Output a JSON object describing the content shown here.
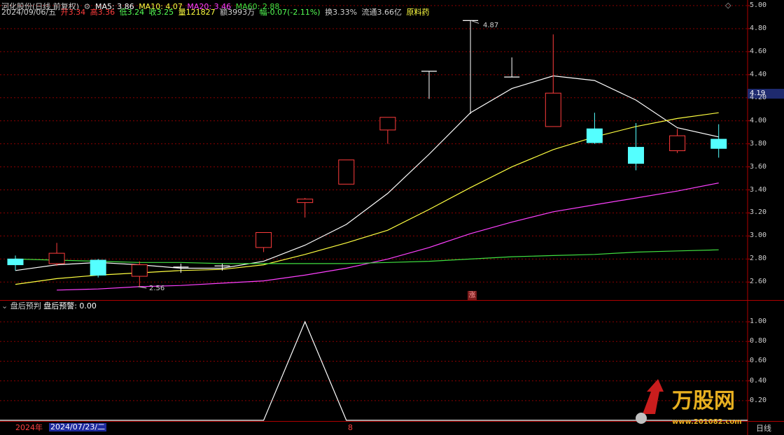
{
  "header": {
    "stock_name": "河化股份(日线 前复权)",
    "ma5_label": "MA5: 3.86",
    "ma10_label": "MA10: 4.07",
    "ma20_label": "MA20: 3.46",
    "ma60_label": "MA60: 2.88",
    "date": "2024/09/06/五",
    "open_label": "开3.34",
    "high_label": "高3.36",
    "low_label": "低3.24",
    "close_label": "收3.25",
    "volume_label": "量121827",
    "amount_label": "额3993万",
    "change_label": "幅-0.07(-2.11%)",
    "turnover_label": "换3.33%",
    "float_label": "流通3.66亿",
    "sector_label": "原料药",
    "corner_icon_text": "◇"
  },
  "indicator": {
    "title": "盘后预判",
    "value_label": "盘后预警: 0.00"
  },
  "footer": {
    "year_label": "2024年",
    "date_label": "2024/07/23/二",
    "marker_label": "8",
    "period_label": "日线"
  },
  "annotations": {
    "high_price": "4.87",
    "low_price": "2.56",
    "limit_up_badge": "涨",
    "current_price_tag": "4.19"
  },
  "watermark": {
    "brand": "万股网",
    "url": "www.201082.com"
  },
  "colors": {
    "up": "#ff3c3c",
    "down": "#54ffff",
    "ma5": "#ffffff",
    "ma10": "#ffff40",
    "ma20": "#ff40ff",
    "ma60": "#40e040",
    "grid": "#8b0000",
    "axis_text": "#d0d0d0"
  },
  "chart_data": [
    {
      "type": "candlestick",
      "title": "河化股份(日线 前复权)",
      "ylim": [
        2.45,
        5.0
      ],
      "y_ticks": [
        2.6,
        2.8,
        3.0,
        3.2,
        3.4,
        3.6,
        3.8,
        4.0,
        4.2,
        4.4,
        4.6,
        4.8,
        5.0
      ],
      "candles": [
        {
          "open": 2.8,
          "high": 2.83,
          "low": 2.7,
          "close": 2.75
        },
        {
          "open": 2.76,
          "high": 2.94,
          "low": 2.74,
          "close": 2.85
        },
        {
          "open": 2.79,
          "high": 2.8,
          "low": 2.64,
          "close": 2.66
        },
        {
          "open": 2.65,
          "high": 2.78,
          "low": 2.56,
          "close": 2.75
        },
        {
          "open": 2.72,
          "high": 2.76,
          "low": 2.68,
          "close": 2.73
        },
        {
          "open": 2.74,
          "high": 2.76,
          "low": 2.7,
          "close": 2.74
        },
        {
          "open": 2.9,
          "high": 3.03,
          "low": 2.86,
          "close": 3.03
        },
        {
          "open": 3.29,
          "high": 3.33,
          "low": 3.16,
          "close": 3.32
        },
        {
          "open": 3.45,
          "high": 3.66,
          "low": 3.45,
          "close": 3.66
        },
        {
          "open": 3.92,
          "high": 4.03,
          "low": 3.8,
          "close": 4.03
        },
        {
          "open": 4.43,
          "high": 4.43,
          "low": 4.19,
          "close": 4.43
        },
        {
          "open": 4.87,
          "high": 4.87,
          "low": 4.06,
          "close": 4.87
        },
        {
          "open": 4.38,
          "high": 4.55,
          "low": 4.38,
          "close": 4.38
        },
        {
          "open": 3.95,
          "high": 4.75,
          "low": 3.95,
          "close": 4.24
        },
        {
          "open": 3.93,
          "high": 4.07,
          "low": 3.8,
          "close": 3.81
        },
        {
          "open": 3.77,
          "high": 3.98,
          "low": 3.57,
          "close": 3.63
        },
        {
          "open": 3.74,
          "high": 3.93,
          "low": 3.72,
          "close": 3.87
        },
        {
          "open": 3.84,
          "high": 3.97,
          "low": 3.68,
          "close": 3.76
        }
      ],
      "series": [
        {
          "name": "MA5",
          "values": [
            2.7,
            2.75,
            2.77,
            2.75,
            2.72,
            2.72,
            2.78,
            2.92,
            3.1,
            3.37,
            3.71,
            4.07,
            4.28,
            4.39,
            4.35,
            4.18,
            3.94,
            3.86
          ]
        },
        {
          "name": "MA10",
          "values": [
            2.58,
            2.63,
            2.66,
            2.68,
            2.7,
            2.71,
            2.75,
            2.84,
            2.94,
            3.05,
            3.23,
            3.42,
            3.6,
            3.75,
            3.86,
            3.95,
            4.02,
            4.07
          ]
        },
        {
          "name": "MA20",
          "values": [
            null,
            2.53,
            2.54,
            2.56,
            2.57,
            2.59,
            2.61,
            2.66,
            2.72,
            2.8,
            2.9,
            3.02,
            3.12,
            3.21,
            3.27,
            3.33,
            3.39,
            3.46
          ]
        },
        {
          "name": "MA60",
          "values": [
            2.8,
            2.79,
            2.78,
            2.77,
            2.77,
            2.76,
            2.76,
            2.76,
            2.76,
            2.77,
            2.78,
            2.8,
            2.82,
            2.83,
            2.84,
            2.86,
            2.87,
            2.88
          ]
        }
      ]
    },
    {
      "type": "line",
      "title": "盘后预判",
      "ylim": [
        0,
        1.1
      ],
      "y_ticks": [
        0.2,
        0.4,
        0.6,
        0.8,
        1.0
      ],
      "series": [
        {
          "name": "盘后预警",
          "values": [
            0,
            0,
            0,
            0,
            0,
            0,
            0,
            1,
            0,
            0,
            0,
            0,
            0,
            0,
            0,
            0,
            0,
            0
          ]
        }
      ]
    }
  ]
}
